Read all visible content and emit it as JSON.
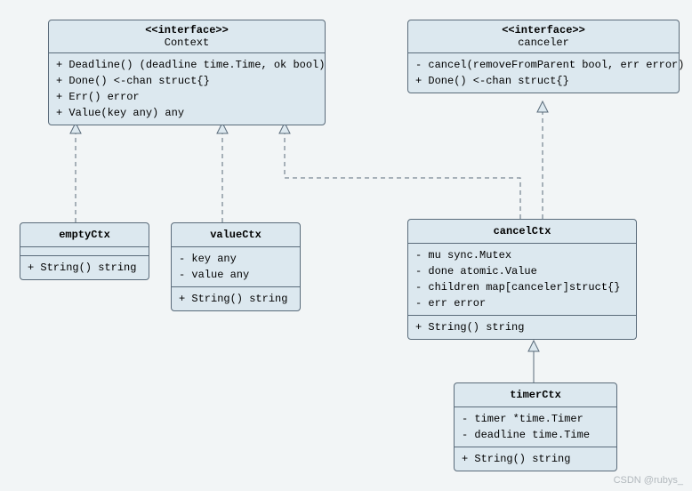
{
  "diagram": {
    "context": {
      "stereo": "<<interface>>",
      "name": "Context",
      "methods": "+ Deadline() (deadline time.Time, ok bool)\n+ Done() <-chan struct{}\n+ Err() error\n+ Value(key any) any"
    },
    "canceler": {
      "stereo": "<<interface>>",
      "name": "canceler",
      "methods": "- cancel(removeFromParent bool, err error)\n+ Done() <-chan struct{}"
    },
    "emptyCtx": {
      "name": "emptyCtx",
      "methods": "+ String() string"
    },
    "valueCtx": {
      "name": "valueCtx",
      "fields": "- key any\n- value any",
      "methods": "+ String() string"
    },
    "cancelCtx": {
      "name": "cancelCtx",
      "fields": "- mu sync.Mutex\n- done atomic.Value\n- children map[canceler]struct{}\n- err error",
      "methods": "+ String() string"
    },
    "timerCtx": {
      "name": "timerCtx",
      "fields": "- timer *time.Timer\n- deadline time.Time",
      "methods": "+ String() string"
    }
  },
  "watermark": "CSDN @rubys_"
}
